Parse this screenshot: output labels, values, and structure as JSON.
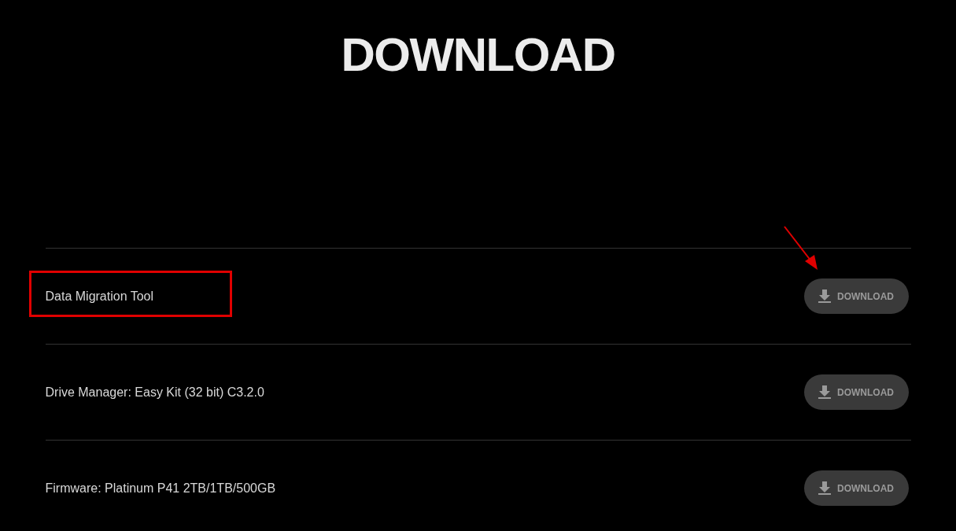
{
  "title": "DOWNLOAD",
  "downloads": [
    {
      "name": "Data Migration Tool",
      "button": "DOWNLOAD",
      "highlighted": true
    },
    {
      "name": "Drive Manager: Easy Kit (32 bit) C3.2.0",
      "button": "DOWNLOAD",
      "highlighted": false
    },
    {
      "name": "Firmware: Platinum P41 2TB/1TB/500GB",
      "button": "DOWNLOAD",
      "highlighted": false
    }
  ]
}
